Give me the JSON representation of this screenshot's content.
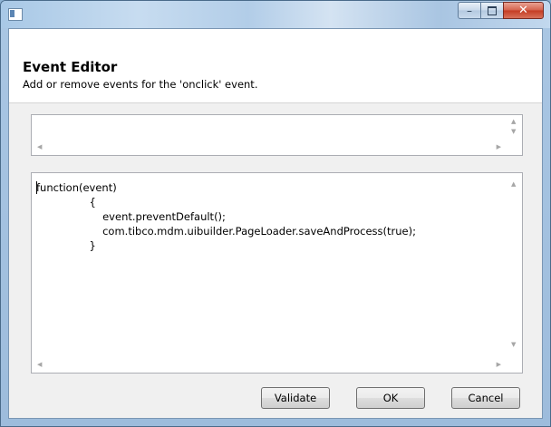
{
  "window": {
    "title": "",
    "controls": {
      "minimize_icon": "minimize-icon",
      "maximize_icon": "maximize-icon",
      "close_icon": "close-icon"
    }
  },
  "header": {
    "title": "Event Editor",
    "description": "Add or remove events for the 'onclick' event."
  },
  "events_list": {
    "items": []
  },
  "editor": {
    "code_lines": [
      "function(event)",
      "                {",
      "                    event.preventDefault();",
      "                    com.tibco.mdm.uibuilder.PageLoader.saveAndProcess(true);",
      "                }"
    ]
  },
  "buttons": {
    "validate": "Validate",
    "ok": "OK",
    "cancel": "Cancel"
  }
}
